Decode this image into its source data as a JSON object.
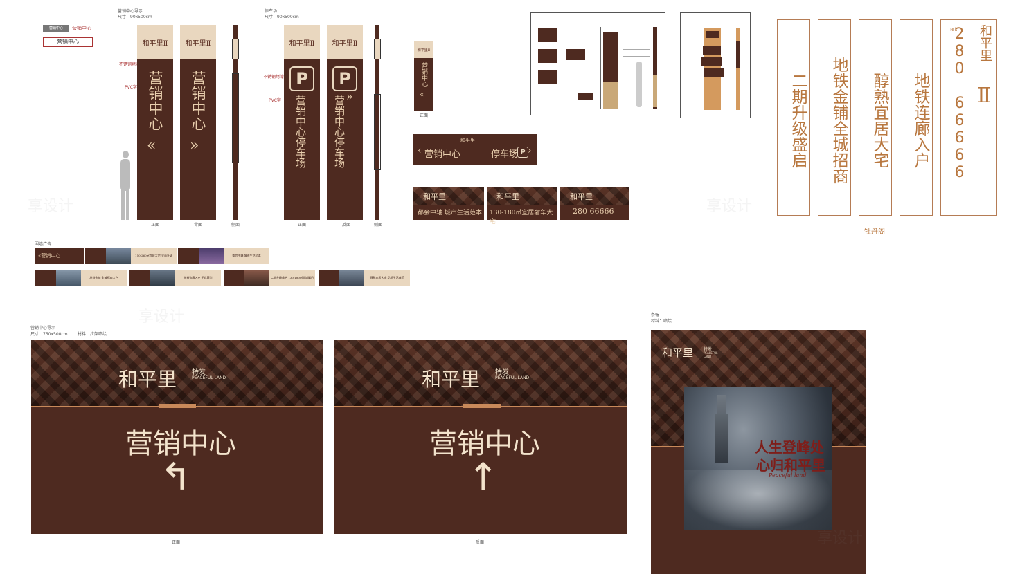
{
  "top_left_sign": {
    "tag": "营销中心",
    "arrow_label": "营销中心",
    "box_label": "营销中心"
  },
  "sales_guide_tall": {
    "title": "营销中心导示",
    "size": "尺寸：90x500cm",
    "brand": "和平里Ⅱ",
    "text": "营销中心",
    "arrow_left": "«",
    "arrow_right": "»",
    "callout_1": "不锈钢烤漆",
    "callout_2": "PVC字",
    "label_front": "正面",
    "label_back": "背面",
    "label_side": "侧面"
  },
  "parking_guide": {
    "title": "停车场",
    "size": "尺寸：90x500cm",
    "brand": "和平里Ⅱ",
    "p": "P",
    "text": "营销中心停车场",
    "arrow": "»",
    "callout_1": "不锈钢烤漆",
    "callout_2": "PVC字",
    "label_front": "正面",
    "label_back": "反面",
    "label_side": "侧面"
  },
  "small_sign": {
    "brand": "和平里Ⅱ",
    "text": "营销中心",
    "arrow": "«",
    "label": "正面"
  },
  "road_sign": {
    "brand": "和平里",
    "left_text": "营销中心",
    "left_arrow": "‹",
    "right_text": "停车场",
    "p": "P",
    "right_arrow": "›"
  },
  "boards": [
    {
      "brand": "和平里",
      "text": "都会中轴 城市生活范本"
    },
    {
      "brand": "和平里",
      "text": "130-180㎡宜居奢华大宅"
    },
    {
      "brand": "和平里",
      "text": "280 66666"
    }
  ],
  "fence_title": "围墙广告",
  "fence_row1": [
    {
      "text": "«营销中心"
    },
    {
      "text": "150-260㎡宜居大宅 全面升级"
    },
    {
      "text": "都会中轴 城市生活范本"
    }
  ],
  "fence_row2": [
    {
      "text": "地铁金铺 全城招商入户"
    },
    {
      "text": "地铁连廊入户 于此繁华"
    },
    {
      "text": "二期升级盛启 130-180㎡全城瞩目"
    },
    {
      "text": "醇熟宜居大宅 品质生活典范"
    }
  ],
  "banners": [
    {
      "text": "二期升级盛启"
    },
    {
      "text": "地铁金铺全城招商"
    },
    {
      "text": "醇熟宜居大宅"
    },
    {
      "text": "地铁连廊入户"
    }
  ],
  "phone_banner": {
    "tel": "Tel:",
    "number": "280 66666",
    "brand": "和平里",
    "numeral": "Ⅱ"
  },
  "banners_caption": "牡丹阁",
  "bottom_guide": {
    "title": "营销中心导示",
    "size": "尺寸：750x500cm",
    "material": "材料：拉架喷绘",
    "brand": "和平里",
    "sub_cn": "特发",
    "sub_en": "PEACEFUL LAND",
    "text": "营销中心",
    "arrow_front": "↰",
    "arrow_back": "↑",
    "label_front": "正面",
    "label_back": "反面"
  },
  "poster": {
    "title": "条幅",
    "material": "材料：喷绘",
    "brand": "和平里",
    "sub_cn": "特发",
    "sub_en": "PEACEFUL LAND",
    "slogan_1": "人生登峰处",
    "slogan_2": "心归和平里",
    "signature": "Peaceful land"
  },
  "watermark": "享设计"
}
